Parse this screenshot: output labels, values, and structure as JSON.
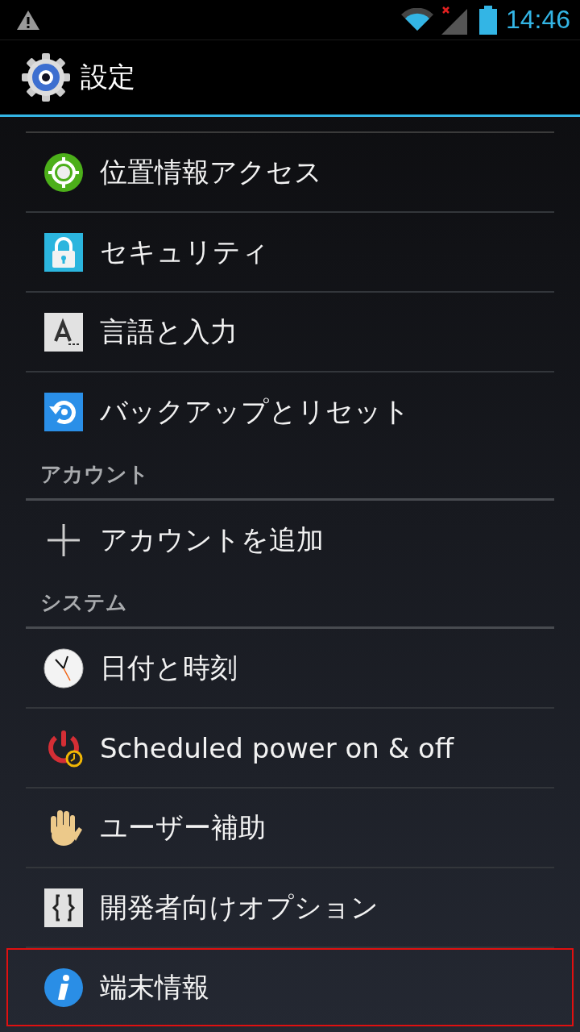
{
  "status_bar": {
    "time": "14:46"
  },
  "action_bar": {
    "title": "設定"
  },
  "sections": [
    {
      "items": [
        {
          "label": "位置情報アクセス",
          "kind": "location",
          "highlighted": false
        },
        {
          "label": "セキュリティ",
          "kind": "lock",
          "highlighted": false
        },
        {
          "label": "言語と入力",
          "kind": "language",
          "highlighted": false
        },
        {
          "label": "バックアップとリセット",
          "kind": "backup",
          "highlighted": false
        }
      ]
    },
    {
      "header": "アカウント",
      "items": [
        {
          "label": "アカウントを追加",
          "kind": "add",
          "highlighted": false
        }
      ]
    },
    {
      "header": "システム",
      "items": [
        {
          "label": "日付と時刻",
          "kind": "clock",
          "highlighted": false
        },
        {
          "label": "Scheduled power on & off",
          "kind": "power",
          "highlighted": false
        },
        {
          "label": "ユーザー補助",
          "kind": "hand",
          "highlighted": false
        },
        {
          "label": "開発者向けオプション",
          "kind": "developer",
          "highlighted": false
        },
        {
          "label": "端末情報",
          "kind": "info",
          "highlighted": true
        }
      ]
    }
  ]
}
